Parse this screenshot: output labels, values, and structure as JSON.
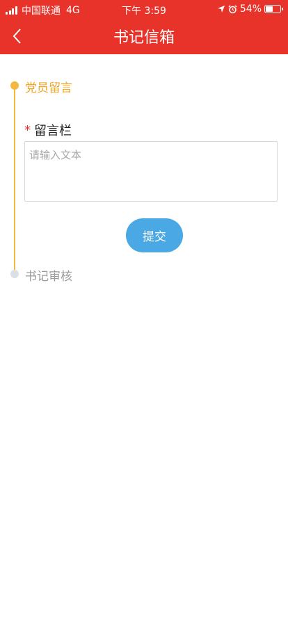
{
  "status_bar": {
    "carrier": "中国联通",
    "network": "4G",
    "time": "下午 3:59",
    "battery_percent": "54%",
    "battery_level": 0.54
  },
  "nav": {
    "title": "书记信箱",
    "back_icon": "chevron-left-icon"
  },
  "steps": [
    {
      "label": "党员留言",
      "state": "active",
      "color": "#f3a525"
    },
    {
      "label": "书记审核",
      "state": "inactive",
      "color": "#9a9a9a"
    }
  ],
  "form": {
    "required_mark": "*",
    "message_label": "留言栏",
    "message_placeholder": "请输入文本",
    "message_value": "",
    "submit_label": "提交"
  },
  "colors": {
    "header": "#e8332a",
    "accent": "#f3b83f",
    "button": "#4aa8e4"
  }
}
